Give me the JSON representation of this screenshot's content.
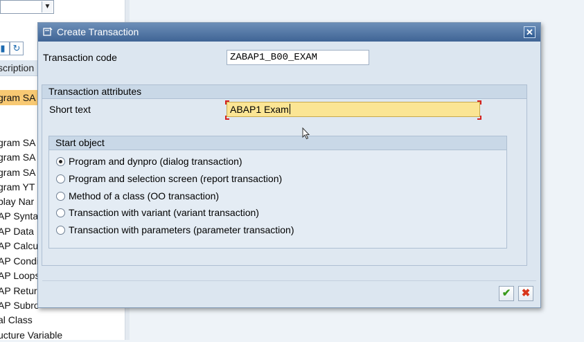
{
  "background": {
    "header_fragment": "scription",
    "selected_row_fragment": "gram SA",
    "rows": [
      "gram SA",
      "gram SA",
      "gram SA",
      "gram YT",
      "play Nar",
      "AP Synta",
      "AP Data",
      "AP Calcu",
      "AP Condi",
      "AP Loops",
      "AP Retur",
      "AP Subro",
      "al Class",
      "ucture Variable"
    ]
  },
  "dialog": {
    "title": "Create Transaction",
    "transaction_code_label": "Transaction code",
    "transaction_code_value": "ZABAP1_B00_EXAM",
    "attributes": {
      "header": "Transaction attributes",
      "short_text_label": "Short text",
      "short_text_value": "ABAP1 Exam"
    },
    "start_object": {
      "header": "Start object",
      "options": [
        {
          "label": "Program and dynpro (dialog transaction)",
          "checked": true
        },
        {
          "label": "Program and selection screen (report transaction)",
          "checked": false
        },
        {
          "label": "Method of a class (OO transaction)",
          "checked": false
        },
        {
          "label": "Transaction with variant (variant transaction)",
          "checked": false
        },
        {
          "label": "Transaction with parameters (parameter transaction)",
          "checked": false
        }
      ]
    },
    "buttons": {
      "ok_icon": "checkmark-icon",
      "cancel_icon": "cancel-x-icon",
      "close_icon": "close-icon"
    }
  },
  "colors": {
    "title_bar": "#4a6fa0",
    "active_field": "#fbe594",
    "selected_row": "#f8c973"
  }
}
